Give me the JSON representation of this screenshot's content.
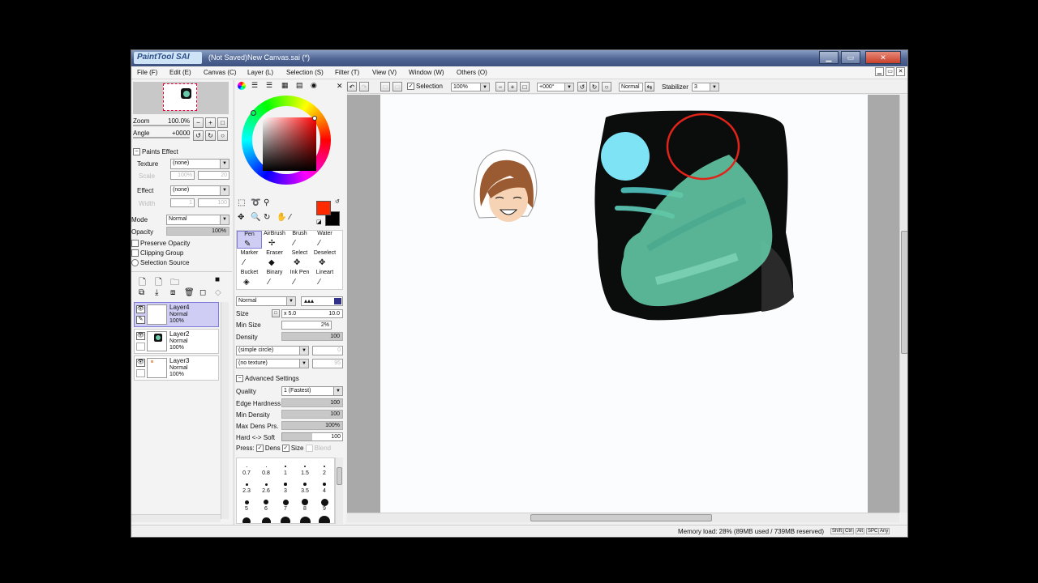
{
  "window": {
    "logo": "PaintTool SAI",
    "title": "(Not Saved)New Canvas.sai (*)",
    "minimize_glyph": "▁",
    "maximize_glyph": "▭",
    "close_glyph": "✕"
  },
  "menu": [
    "File (F)",
    "Edit (E)",
    "Canvas (C)",
    "Layer (L)",
    "Selection (S)",
    "Filter (T)",
    "View (V)",
    "Window (W)",
    "Others (O)"
  ],
  "navigator": {
    "zoom_label": "Zoom",
    "zoom_value": "100.0%",
    "angle_label": "Angle",
    "angle_value": "+0000"
  },
  "paints_effect": {
    "header": "Paints Effect",
    "texture_label": "Texture",
    "texture_value": "(none)",
    "scale_label": "Scale",
    "scale_value": "100%",
    "scale_num": "20",
    "effect_label": "Effect",
    "effect_value": "(none)",
    "width_label": "Width",
    "width_value": "1",
    "width_num": "100"
  },
  "layer_props": {
    "mode_label": "Mode",
    "mode_value": "Normal",
    "opacity_label": "Opacity",
    "opacity_value": "100%",
    "preserve_opacity": "Preserve Opacity",
    "clipping_group": "Clipping Group",
    "selection_source": "Selection Source"
  },
  "layers": [
    {
      "name": "Layer4",
      "mode": "Normal",
      "opacity": "100%",
      "selected": true
    },
    {
      "name": "Layer2",
      "mode": "Normal",
      "opacity": "100%",
      "selected": false
    },
    {
      "name": "Layer3",
      "mode": "Normal",
      "opacity": "100%",
      "selected": false
    }
  ],
  "colors": {
    "primary": "#ff2a00",
    "secondary": "#000000"
  },
  "tools": [
    {
      "label": "Pen",
      "icon": "✎"
    },
    {
      "label": "AirBrush",
      "icon": "✢"
    },
    {
      "label": "Brush",
      "icon": "⁄"
    },
    {
      "label": "Water",
      "icon": "⁄"
    },
    {
      "label": "Marker",
      "icon": "⁄"
    },
    {
      "label": "Eraser",
      "icon": "◆"
    },
    {
      "label": "Select",
      "icon": "✥"
    },
    {
      "label": "Deselect",
      "icon": "✥"
    },
    {
      "label": "Bucket",
      "icon": "◈"
    },
    {
      "label": "Binary",
      "icon": "⁄"
    },
    {
      "label": "Ink Pen",
      "icon": "⁄"
    },
    {
      "label": "Lineart",
      "icon": "⁄"
    }
  ],
  "brush": {
    "blend_mode": "Normal",
    "size_label": "Size",
    "size_mult": "x 5.0",
    "size_value": "10.0",
    "min_size_label": "Min Size",
    "min_size_value": "2%",
    "density_label": "Density",
    "density_value": "100",
    "shape": "(simple circle)",
    "shape_num": "0",
    "texture": "(no texture)",
    "texture_num": "95",
    "advanced_header": "Advanced Settings",
    "quality_label": "Quality",
    "quality_value": "1 (Fastest)",
    "edge_hardness_label": "Edge Hardness",
    "edge_hardness_value": "100",
    "min_density_label": "Min Density",
    "min_density_value": "100",
    "max_dens_label": "Max Dens Prs.",
    "max_dens_value": "100%",
    "hard_soft_label": "Hard <-> Soft",
    "hard_soft_value": "100",
    "press_label": "Press:",
    "press_dens": "Dens",
    "press_size": "Size",
    "press_blend": "Blend"
  },
  "brush_sizes": [
    "0.7",
    "0.8",
    "1",
    "1.5",
    "2",
    "2.3",
    "2.6",
    "3",
    "3.5",
    "4",
    "5",
    "6",
    "7",
    "8",
    "9"
  ],
  "canvas_toolbar": {
    "selection_label": "Selection",
    "zoom": "100%",
    "angle": "+000°",
    "mode": "Normal",
    "stabilizer_label": "Stabilizer",
    "stabilizer_value": "3"
  },
  "status": {
    "memory": "Memory load: 28% (89MB used / 739MB reserved)",
    "keys": [
      "Shift",
      "Ctrl",
      "Alt",
      "SPC",
      "Any"
    ]
  }
}
